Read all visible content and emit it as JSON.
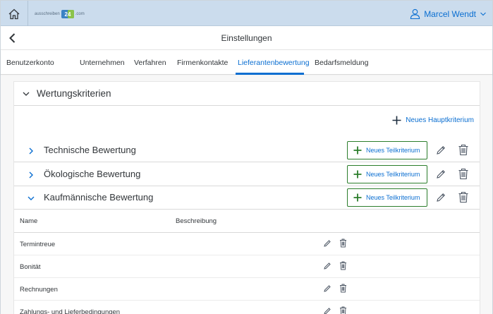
{
  "header": {
    "logo_text_prefix": "ausschreiben",
    "logo_text_suffix": ".com",
    "user_name": "Marcel Wendt"
  },
  "titlebar": {
    "title": "Einstellungen"
  },
  "tabs": [
    {
      "label": "Benutzerkonto"
    },
    {
      "label": "Unternehmen"
    },
    {
      "label": "Verfahren"
    },
    {
      "label": "Firmenkontakte"
    },
    {
      "label": "Lieferantenbewertung",
      "active": true
    },
    {
      "label": "Bedarfsmeldung"
    }
  ],
  "panel": {
    "title": "Wertungskriterien",
    "new_main_label": "Neues Hauptkriterium",
    "sections": [
      {
        "title": "Technische Bewertung",
        "expanded": false,
        "button_label": "Neues Teilkriterium"
      },
      {
        "title": "Ökologische Bewertung",
        "expanded": false,
        "button_label": "Neues Teilkriterium"
      },
      {
        "title": "Kaufmännische Bewertung",
        "expanded": true,
        "button_label": "Neues Teilkriterium"
      }
    ],
    "table": {
      "columns": [
        "Name",
        "Beschreibung"
      ],
      "rows": [
        {
          "name": "Termintreue",
          "description": ""
        },
        {
          "name": "Bonität",
          "description": ""
        },
        {
          "name": "Rechnungen",
          "description": ""
        },
        {
          "name": "Zahlungs- und Lieferbedingungen",
          "description": ""
        }
      ]
    }
  },
  "colors": {
    "accent": "#0a6ed1",
    "topbar": "#cbdced",
    "button_border": "#2b7d2b",
    "plus_green": "#2b7d2b",
    "icon_grey": "#4b5563"
  }
}
